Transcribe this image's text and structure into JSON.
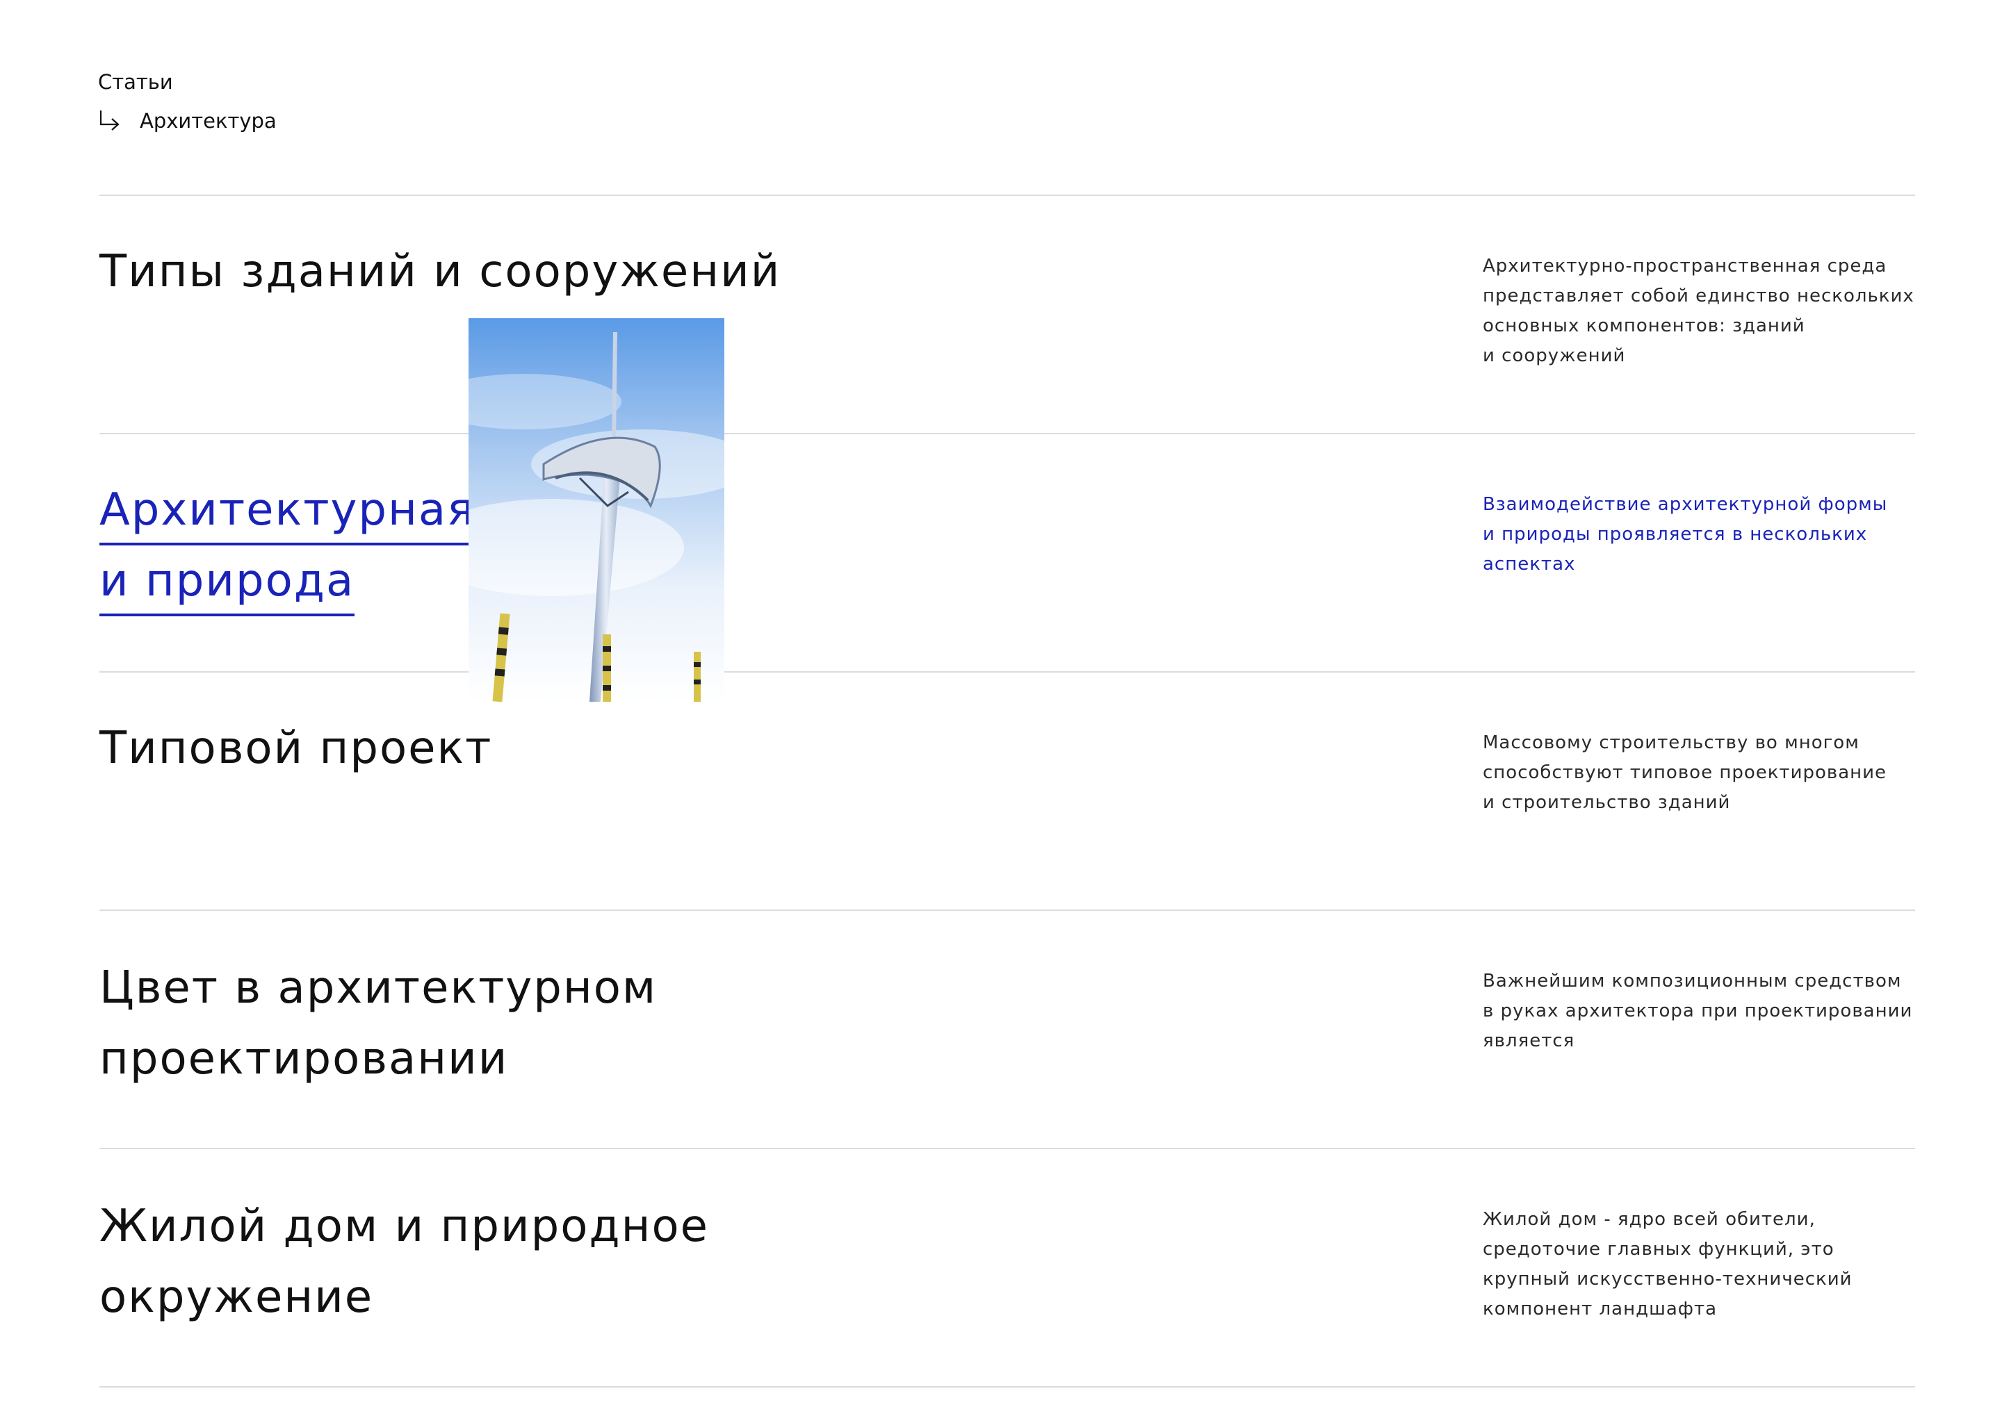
{
  "breadcrumb": {
    "root": "Статьи",
    "current": "Архитектура"
  },
  "colors": {
    "accent": "#1a23b8",
    "text": "#111111",
    "divider": "#dcdcdc"
  },
  "icons": {
    "breadcrumb_arrow": "corner-down-right-arrow-icon"
  },
  "articles": [
    {
      "title": "Типы зданий и сооружений",
      "description": "Архитектурно-пространственная среда\nпредставляет собой единство нескольких\nосновных компонентов: зданий\nи сооружений",
      "active": false
    },
    {
      "title_lines": [
        "Архитектурная форма",
        "и природа"
      ],
      "description": "Взаимодействие архитектурной формы\nи природы проявляется в нескольких\nаспектах",
      "active": true
    },
    {
      "title": "Типовой проект",
      "description": "Массовому строительству во многом\nспособствуют типовое проектирование\nи строительство зданий",
      "active": false
    },
    {
      "title": "Цвет в архитектурном\nпроектировании",
      "description": "Важнейшим композиционным средством\nв руках архитектора при проектировании\nявляется",
      "active": false
    },
    {
      "title": "Жилой дом и природное\nокружение",
      "description": "Жилой дом - ядро всей обители,\nсредоточие главных функций, это\nкрупный искусственно-технический\nкомпонент ландшафта",
      "active": false
    }
  ],
  "hover_image": {
    "subject": "communication-tower-photo"
  }
}
